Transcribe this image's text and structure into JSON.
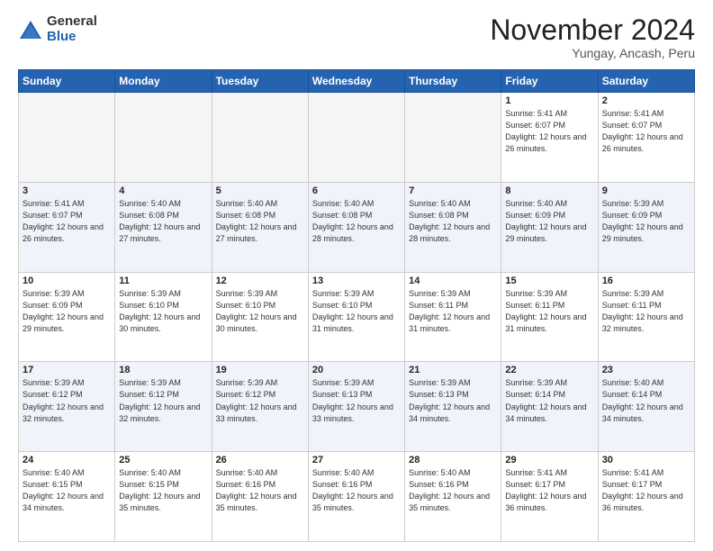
{
  "header": {
    "logo_general": "General",
    "logo_blue": "Blue",
    "month_title": "November 2024",
    "location": "Yungay, Ancash, Peru"
  },
  "days_of_week": [
    "Sunday",
    "Monday",
    "Tuesday",
    "Wednesday",
    "Thursday",
    "Friday",
    "Saturday"
  ],
  "weeks": [
    [
      {
        "day": "",
        "empty": true
      },
      {
        "day": "",
        "empty": true
      },
      {
        "day": "",
        "empty": true
      },
      {
        "day": "",
        "empty": true
      },
      {
        "day": "",
        "empty": true
      },
      {
        "day": "1",
        "sunrise": "5:41 AM",
        "sunset": "6:07 PM",
        "daylight": "12 hours and 26 minutes."
      },
      {
        "day": "2",
        "sunrise": "5:41 AM",
        "sunset": "6:07 PM",
        "daylight": "12 hours and 26 minutes."
      }
    ],
    [
      {
        "day": "3",
        "sunrise": "5:41 AM",
        "sunset": "6:07 PM",
        "daylight": "12 hours and 26 minutes."
      },
      {
        "day": "4",
        "sunrise": "5:40 AM",
        "sunset": "6:08 PM",
        "daylight": "12 hours and 27 minutes."
      },
      {
        "day": "5",
        "sunrise": "5:40 AM",
        "sunset": "6:08 PM",
        "daylight": "12 hours and 27 minutes."
      },
      {
        "day": "6",
        "sunrise": "5:40 AM",
        "sunset": "6:08 PM",
        "daylight": "12 hours and 28 minutes."
      },
      {
        "day": "7",
        "sunrise": "5:40 AM",
        "sunset": "6:08 PM",
        "daylight": "12 hours and 28 minutes."
      },
      {
        "day": "8",
        "sunrise": "5:40 AM",
        "sunset": "6:09 PM",
        "daylight": "12 hours and 29 minutes."
      },
      {
        "day": "9",
        "sunrise": "5:39 AM",
        "sunset": "6:09 PM",
        "daylight": "12 hours and 29 minutes."
      }
    ],
    [
      {
        "day": "10",
        "sunrise": "5:39 AM",
        "sunset": "6:09 PM",
        "daylight": "12 hours and 29 minutes."
      },
      {
        "day": "11",
        "sunrise": "5:39 AM",
        "sunset": "6:10 PM",
        "daylight": "12 hours and 30 minutes."
      },
      {
        "day": "12",
        "sunrise": "5:39 AM",
        "sunset": "6:10 PM",
        "daylight": "12 hours and 30 minutes."
      },
      {
        "day": "13",
        "sunrise": "5:39 AM",
        "sunset": "6:10 PM",
        "daylight": "12 hours and 31 minutes."
      },
      {
        "day": "14",
        "sunrise": "5:39 AM",
        "sunset": "6:11 PM",
        "daylight": "12 hours and 31 minutes."
      },
      {
        "day": "15",
        "sunrise": "5:39 AM",
        "sunset": "6:11 PM",
        "daylight": "12 hours and 31 minutes."
      },
      {
        "day": "16",
        "sunrise": "5:39 AM",
        "sunset": "6:11 PM",
        "daylight": "12 hours and 32 minutes."
      }
    ],
    [
      {
        "day": "17",
        "sunrise": "5:39 AM",
        "sunset": "6:12 PM",
        "daylight": "12 hours and 32 minutes."
      },
      {
        "day": "18",
        "sunrise": "5:39 AM",
        "sunset": "6:12 PM",
        "daylight": "12 hours and 32 minutes."
      },
      {
        "day": "19",
        "sunrise": "5:39 AM",
        "sunset": "6:12 PM",
        "daylight": "12 hours and 33 minutes."
      },
      {
        "day": "20",
        "sunrise": "5:39 AM",
        "sunset": "6:13 PM",
        "daylight": "12 hours and 33 minutes."
      },
      {
        "day": "21",
        "sunrise": "5:39 AM",
        "sunset": "6:13 PM",
        "daylight": "12 hours and 34 minutes."
      },
      {
        "day": "22",
        "sunrise": "5:39 AM",
        "sunset": "6:14 PM",
        "daylight": "12 hours and 34 minutes."
      },
      {
        "day": "23",
        "sunrise": "5:40 AM",
        "sunset": "6:14 PM",
        "daylight": "12 hours and 34 minutes."
      }
    ],
    [
      {
        "day": "24",
        "sunrise": "5:40 AM",
        "sunset": "6:15 PM",
        "daylight": "12 hours and 34 minutes."
      },
      {
        "day": "25",
        "sunrise": "5:40 AM",
        "sunset": "6:15 PM",
        "daylight": "12 hours and 35 minutes."
      },
      {
        "day": "26",
        "sunrise": "5:40 AM",
        "sunset": "6:16 PM",
        "daylight": "12 hours and 35 minutes."
      },
      {
        "day": "27",
        "sunrise": "5:40 AM",
        "sunset": "6:16 PM",
        "daylight": "12 hours and 35 minutes."
      },
      {
        "day": "28",
        "sunrise": "5:40 AM",
        "sunset": "6:16 PM",
        "daylight": "12 hours and 35 minutes."
      },
      {
        "day": "29",
        "sunrise": "5:41 AM",
        "sunset": "6:17 PM",
        "daylight": "12 hours and 36 minutes."
      },
      {
        "day": "30",
        "sunrise": "5:41 AM",
        "sunset": "6:17 PM",
        "daylight": "12 hours and 36 minutes."
      }
    ]
  ]
}
